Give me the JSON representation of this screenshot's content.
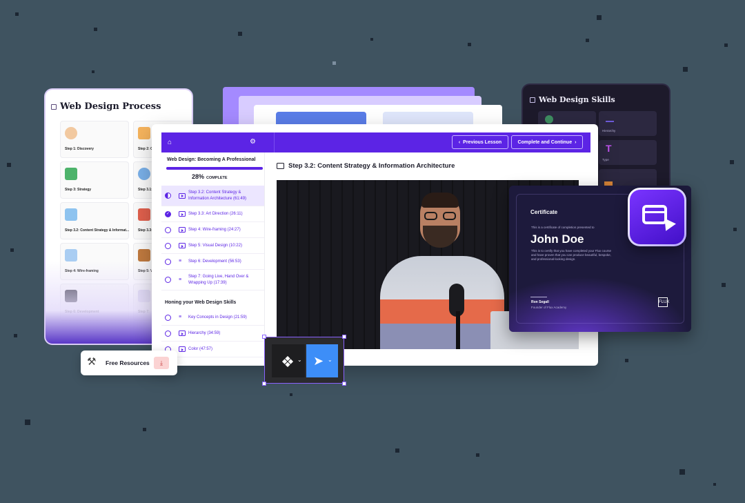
{
  "process_card": {
    "title": "Web Design Process",
    "steps": [
      "Step 1: Discovery",
      "Step 2: C",
      "Step 3: Strategy",
      "Step 3.1: ",
      "Step 3.2: Content Strategy & Informat...",
      "Step 3.3: ",
      "Step 4: Wire-framing",
      "Step 5: V",
      "Step 6: Development",
      "Step 7: "
    ]
  },
  "skills_card": {
    "title": "Web Design Skills",
    "tiles": [
      "Hierarchy",
      "Type"
    ],
    "type_glyph": "T"
  },
  "lesson_window": {
    "course_title": "Web Design: Becoming A Professional",
    "progress_percent": 28,
    "progress_text": "28%",
    "progress_suffix": "COMPLETE",
    "prev_label": "Previous Lesson",
    "prev_chevron": "‹",
    "next_label": "Complete and Continue",
    "next_chevron": "›",
    "content_title": "Step 3.2: Content Strategy & Information Architecture",
    "lessons": [
      {
        "title": "Step 3.2: Content Strategy & Information Architecture (61:49)",
        "status": "half",
        "type": "video"
      },
      {
        "title": "Step 3.3: Art Direction (26:11)",
        "status": "done",
        "type": "video"
      },
      {
        "title": "Step 4: Wire-framing (24:27)",
        "status": "todo",
        "type": "video"
      },
      {
        "title": "Step 5: Visual Design (10:22)",
        "status": "todo",
        "type": "video"
      },
      {
        "title": "Step 6: Development (56:53)",
        "status": "todo",
        "type": "list"
      },
      {
        "title": "Step 7: Going Live, Hand Over & Wrapping Up (17:39)",
        "status": "todo",
        "type": "list"
      }
    ],
    "section_title": "Honing your Web Design Skills",
    "section_lessons": [
      {
        "title": "Key Concepts in Design (21:59)",
        "type": "list"
      },
      {
        "title": "Hierarchy (34:59)",
        "type": "video"
      },
      {
        "title": "Color (47:57)",
        "type": "video"
      }
    ],
    "done_check": "✓",
    "list_glyph": "≡"
  },
  "certificate": {
    "label": "Certificate",
    "intro": "This is a certificate of completion presented to",
    "name": "John Doe",
    "body": "This is to certify that you have completed your Flux course and have proven that you can produce beautiful, bespoke, and professional-looking design.",
    "signer": "Ron Segall",
    "signer_role": "Founder of Flux Academy",
    "logo_text": "FLUX"
  },
  "free_resources": {
    "label": "Free Resources",
    "tool_glyph": "⚒",
    "download_glyph": "⤓"
  },
  "figma_toolbar": {
    "logo_glyph": "❖",
    "cursor_glyph": "➤",
    "chevron": "⌄"
  },
  "colors": {
    "brand_purple": "#5c24e5",
    "cursor_blue": "#3d8ef8",
    "certificate_bg": "#1d1a3c"
  },
  "icons": {
    "home": "⌂",
    "gear": "⚙"
  }
}
